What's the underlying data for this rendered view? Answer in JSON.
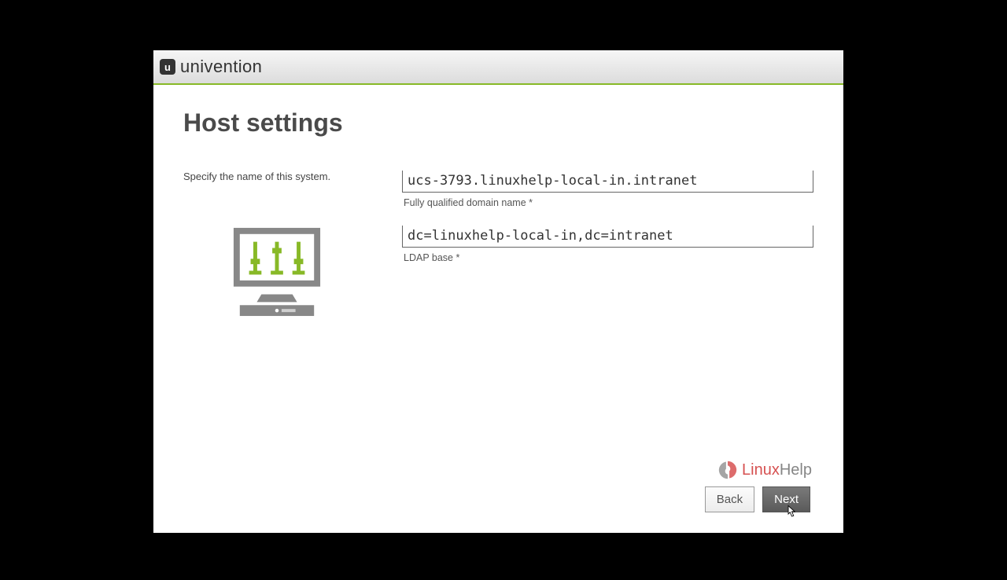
{
  "header": {
    "brand": "univention",
    "logo_glyph": "u"
  },
  "page": {
    "title": "Host settings",
    "prompt": "Specify the name of this system."
  },
  "fields": {
    "fqdn": {
      "value": "ucs-3793.linuxhelp-local-in.intranet",
      "label": "Fully qualified domain name *"
    },
    "ldap": {
      "value": "dc=linuxhelp-local-in,dc=intranet",
      "label": "LDAP base *"
    }
  },
  "buttons": {
    "back": "Back",
    "next": "Next"
  },
  "watermark": {
    "text_main": "Linux",
    "text_sub": "Help"
  },
  "colors": {
    "accent_green": "#88b927",
    "text_dark": "#4a4a4a"
  }
}
